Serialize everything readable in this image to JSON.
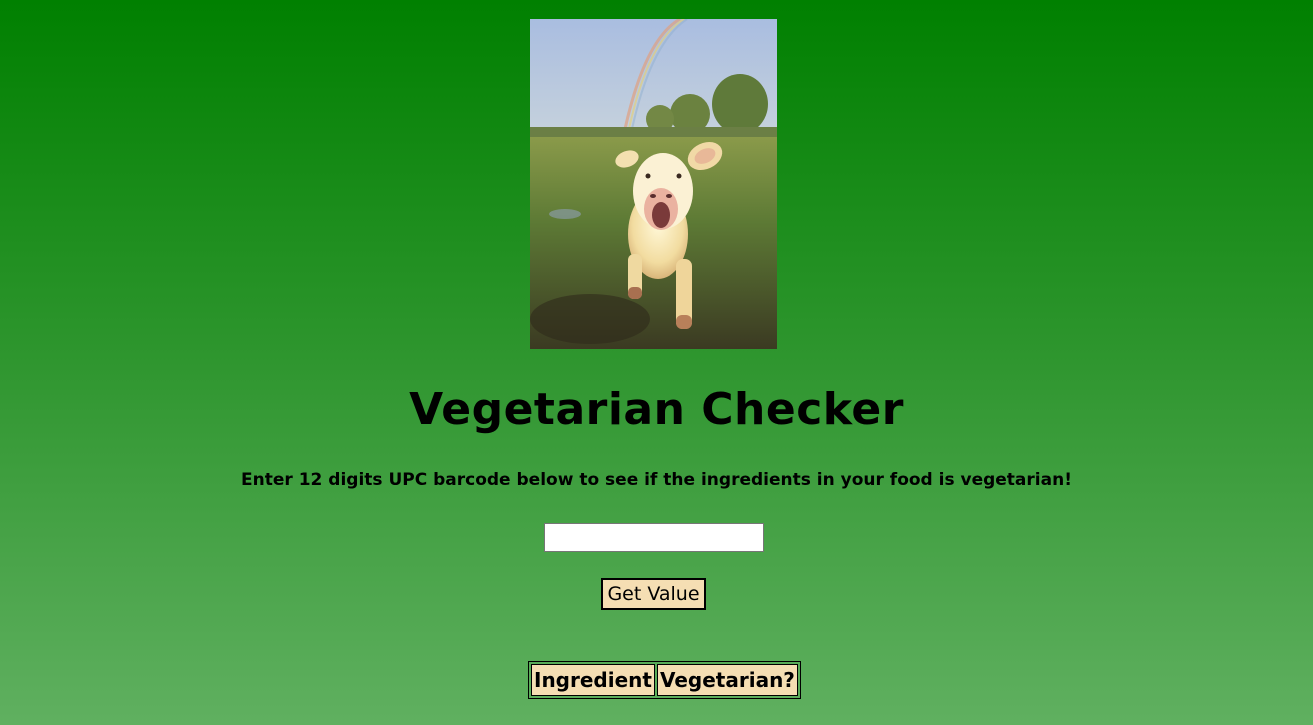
{
  "app": {
    "title": "Vegetarian Checker",
    "subtitle": "Enter 12 digits UPC barcode below to see if the ingredients in your food is vegetarian!"
  },
  "photo": {
    "subject": "calf-in-field-with-rainbow"
  },
  "form": {
    "upc_value": "",
    "upc_placeholder": "",
    "submit_label": "Get Value"
  },
  "results_table": {
    "columns": [
      "Ingredient",
      "Vegetarian?"
    ],
    "rows": []
  },
  "colors": {
    "background_top": "#008000",
    "background_bottom": "#60b060",
    "button_fill": "#f5deb3",
    "header_fill": "#f5deb3"
  }
}
